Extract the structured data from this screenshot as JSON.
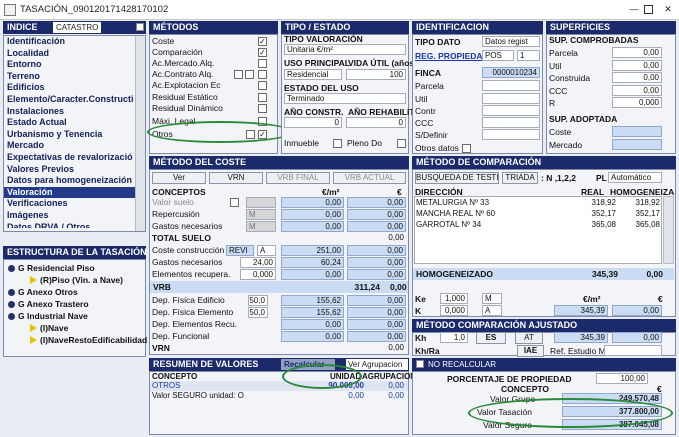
{
  "window": {
    "title": "TASACIÓN_090120171428170102"
  },
  "left": {
    "indice": "INDICE",
    "catastro": "CATASTRO",
    "nav": [
      "Identificación",
      "Localidad",
      "Entorno",
      "Terreno",
      "Edificios",
      "Elemento/Caracter.Constructi",
      "Instalaciones",
      "Estado Actual",
      "Urbanismo y Tenencia",
      "Mercado",
      "Expectativas de revalorizació",
      "Valores Previos",
      "Datos para homogeneización",
      "Valoración",
      "Verificaciones",
      "Imágenes",
      "Datos DRVA / Otros"
    ],
    "estructura": "ESTRUCTURA DE LA TASACIÓN",
    "tree": [
      "G Residencial Piso",
      "(R)Piso (Vin. a Nave)",
      "G Anexo Otros",
      "G Anexo Trastero",
      "G Industrial Nave",
      "(I)Nave",
      "(I)NaveRestoEdificabilidad"
    ]
  },
  "metodos": {
    "title": "MÉTODOS",
    "items": [
      "Coste",
      "Comparación",
      "Ac.Mercado.Alq.",
      "Ac.Contrato Alq.",
      "Ac.Explotacion Ec",
      "Residual Estático",
      "Residual Dinámico",
      "Máxi. Legal",
      "Otros"
    ]
  },
  "tipo": {
    "title": "TIPO / ESTADO",
    "valoracion_label": "TIPO VALORACIÓN",
    "valoracion": "Unitaria €/m²",
    "uso_label": "USO PRINCIPAL",
    "uso": "Residencial",
    "vida_label": "VIDA ÚTIL (años)",
    "vida": "100",
    "estado_label": "ESTADO DEL USO",
    "estado": "Terminado",
    "constr_label": "AÑO CONSTR.",
    "constr": "0",
    "rehab_label": "AÑO REHABILITA",
    "rehab": "0",
    "inmueble": "Inmueble",
    "pleno": "Pleno Do"
  },
  "ident": {
    "title": "IDENTIFICACION",
    "tipo_dato": "TIPO DATO",
    "datos_regist": "Datos regist",
    "reg_prop": "REG. PROPIEDAD",
    "pos": "POS",
    "pos_n": "1",
    "finca": "FINCA",
    "finca_val": "0000010234",
    "rows": [
      "Parcela",
      "Util",
      "Contr",
      "CCC",
      "S/Definir"
    ],
    "otros": "Otros datos"
  },
  "superf": {
    "title": "SUPERFICIES",
    "comp": "SUP. COMPROBADAS",
    "rows": [
      {
        "l": "Parcela",
        "v": "0,00"
      },
      {
        "l": "Util",
        "v": "0,00"
      },
      {
        "l": "Construida",
        "v": "0,00"
      },
      {
        "l": "CCC",
        "v": "0,00"
      },
      {
        "l": "R",
        "v": "0,000"
      }
    ],
    "adop": "SUP. ADOPTADA",
    "coste": "Coste",
    "mercado": "Mercado"
  },
  "coste": {
    "title": "MÉTODO DEL COSTE",
    "ver": "Ver",
    "vrn": "VRN",
    "vrb_final": "VRB FINAL",
    "vrb_actual": "VRB ACTUAL",
    "conceptos": "CONCEPTOS",
    "eur_m2": "€/m²",
    "eur": "€",
    "rows": [
      {
        "l": "Valor suelo",
        "a": "0,00",
        "b": "0,00"
      },
      {
        "l": "Repercusión",
        "a": "0,00",
        "b": "0,00"
      },
      {
        "l": "Gastos necesarios",
        "a": "0,00",
        "b": "0,00"
      }
    ],
    "total_suelo": "TOTAL SUELO",
    "total_suelo_v": "0,00",
    "constr": "Coste construcción",
    "revi": "REVI",
    "constr_a": "251,00",
    "constr_b": "0,00",
    "gastos": "Gastos necesarios",
    "gastos_p": "24,00",
    "gastos_a": "60,24",
    "gastos_b": "0,00",
    "elem": "Elementos recupera.",
    "elem_p": "0,000",
    "elem_a": "0,00",
    "elem_b": "0,00",
    "vrb": "VRB",
    "vrb_a": "311,24",
    "vrb_b": "0,00",
    "deps": [
      {
        "l": "Dep. Física Edificio",
        "p": "50,0",
        "a": "155,62",
        "b": "0,00"
      },
      {
        "l": "Dep. Física Elemento",
        "p": "50,0",
        "a": "155,62",
        "b": "0,00"
      },
      {
        "l": "Dep. Elementos Recu.",
        "p": "",
        "a": "0,00",
        "b": "0,00"
      },
      {
        "l": "Dep. Funcional",
        "p": "",
        "a": "0,00",
        "b": "0,00"
      }
    ],
    "vrn_l": "VRN",
    "vrn_b": "0,00"
  },
  "comp": {
    "title": "MÉTODO DE COMPARACIÓN",
    "busq": "BUSQUEDA DE TESTIGOS",
    "triada": "TRIADA",
    "n": ": N ,1,2,2",
    "pl": "PL",
    "auto": "Automático",
    "direccion": "DIRECCIÓN",
    "real": "REAL",
    "homog": "HOMOGENEIZA",
    "testigos": [
      {
        "d": "METALURGIA Nº 33",
        "r": "318,92",
        "h": "318,92"
      },
      {
        "d": "MANCHA REAL Nº 60",
        "r": "352,17",
        "h": "352,17"
      },
      {
        "d": "GARROTAL Nº 34",
        "r": "365,08",
        "h": "365,08"
      }
    ],
    "homogeneizado": "HOMOGENEIZADO",
    "homog_v": "345,39",
    "homog_e": "0,00",
    "ke": "Ke",
    "ke_v": "1,000",
    "m": "M",
    "k": "K",
    "k_v": "0,000",
    "a": "A",
    "eur_m2": "€/m²",
    "eur": "€",
    "k_row_a": "345,39",
    "k_row_b": "0,00"
  },
  "ajust": {
    "title": "MÉTODO COMPARACIÓN AJUSTADO",
    "kh": "Kh",
    "kh_v": "1,0",
    "es": "ES",
    "at": "AT",
    "at_v": "345,39",
    "at_e": "0,00",
    "khra": "Kh/Ra",
    "iae": "IAE",
    "ref": "Ref. Estudio M"
  },
  "resumen": {
    "title": "RESUMEN DE VALORES",
    "recalc": "Recalcular",
    "ver_agr": "Ver Agrupacion",
    "no_recalc": "NO RECALCULAR",
    "concepto": "CONCEPTO",
    "unidad": "UNIDAD",
    "agrupacion": "AGRUPACION",
    "otros": "OTROS",
    "otros_u": "90.000,00",
    "otros_a": "0,00",
    "seguro": "Valor SEGURO unidad: O",
    "seguro_u": "0,00",
    "seguro_a": "0,00"
  },
  "totales": {
    "porc_label": "PORCENTAJE DE PROPIEDAD",
    "porc": "100,00",
    "concepto": "CONCEPTO",
    "eur": "€",
    "rows": [
      {
        "l": "Valor Grupo",
        "v": "249.570,48"
      },
      {
        "l": "Valor Tasación",
        "v": "377.800,00"
      },
      {
        "l": "Valor Seguro",
        "v": "387.045,08"
      }
    ]
  }
}
